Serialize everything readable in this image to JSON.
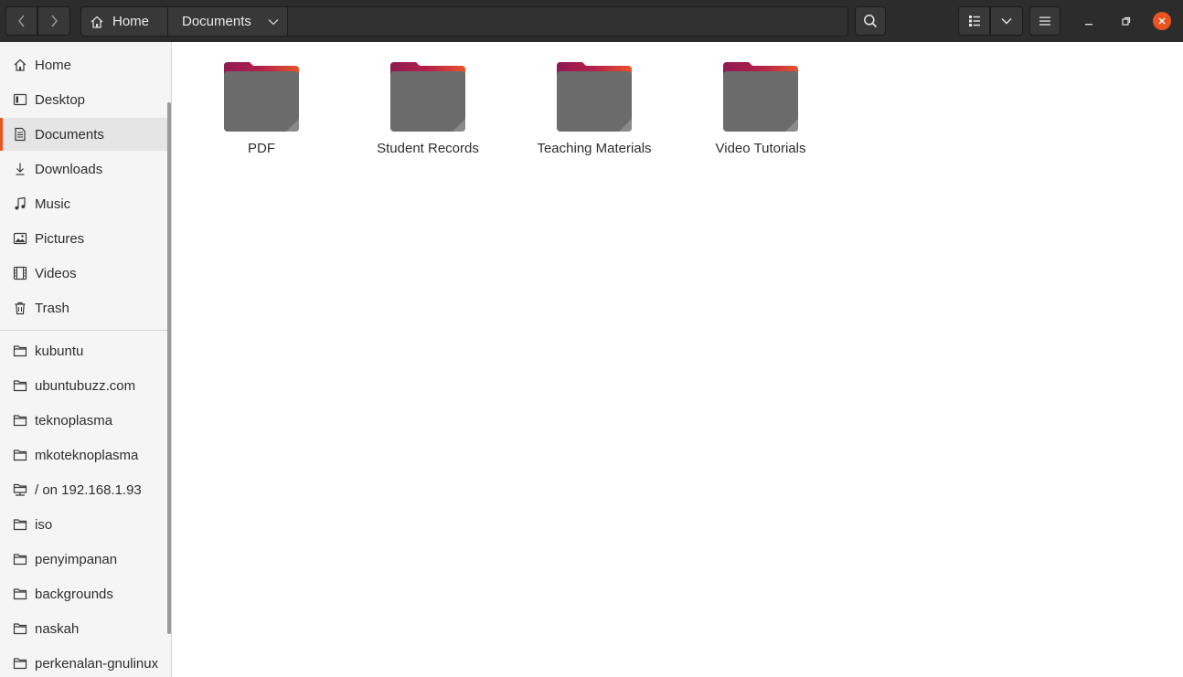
{
  "header": {
    "path": {
      "home_label": "Home",
      "current_label": "Documents"
    }
  },
  "sidebar": {
    "places": [
      {
        "label": "Home",
        "icon": "home-icon"
      },
      {
        "label": "Desktop",
        "icon": "desktop-icon"
      },
      {
        "label": "Documents",
        "icon": "document-icon",
        "active": true
      },
      {
        "label": "Downloads",
        "icon": "download-icon"
      },
      {
        "label": "Music",
        "icon": "music-icon"
      },
      {
        "label": "Pictures",
        "icon": "picture-icon"
      },
      {
        "label": "Videos",
        "icon": "video-icon"
      },
      {
        "label": "Trash",
        "icon": "trash-icon"
      }
    ],
    "bookmarks": [
      {
        "label": "kubuntu",
        "icon": "folder-icon"
      },
      {
        "label": "ubuntubuzz.com",
        "icon": "folder-icon"
      },
      {
        "label": "teknoplasma",
        "icon": "folder-icon"
      },
      {
        "label": "mkoteknoplasma",
        "icon": "folder-icon"
      },
      {
        "label": "/ on 192.168.1.93",
        "icon": "network-folder-icon"
      },
      {
        "label": "iso",
        "icon": "folder-icon"
      },
      {
        "label": "penyimpanan",
        "icon": "folder-icon"
      },
      {
        "label": "backgrounds",
        "icon": "folder-icon"
      },
      {
        "label": "naskah",
        "icon": "folder-icon"
      },
      {
        "label": "perkenalan-gnulinux",
        "icon": "folder-icon"
      }
    ]
  },
  "content": {
    "folders": [
      {
        "label": "PDF"
      },
      {
        "label": "Student Records"
      },
      {
        "label": "Teaching Materials"
      },
      {
        "label": "Video Tutorials"
      }
    ]
  },
  "colors": {
    "accent": "#e95420",
    "headerbar": "#2c2c2c",
    "folder_tab": "#a0144f",
    "folder_body": "#6e6e6e"
  }
}
